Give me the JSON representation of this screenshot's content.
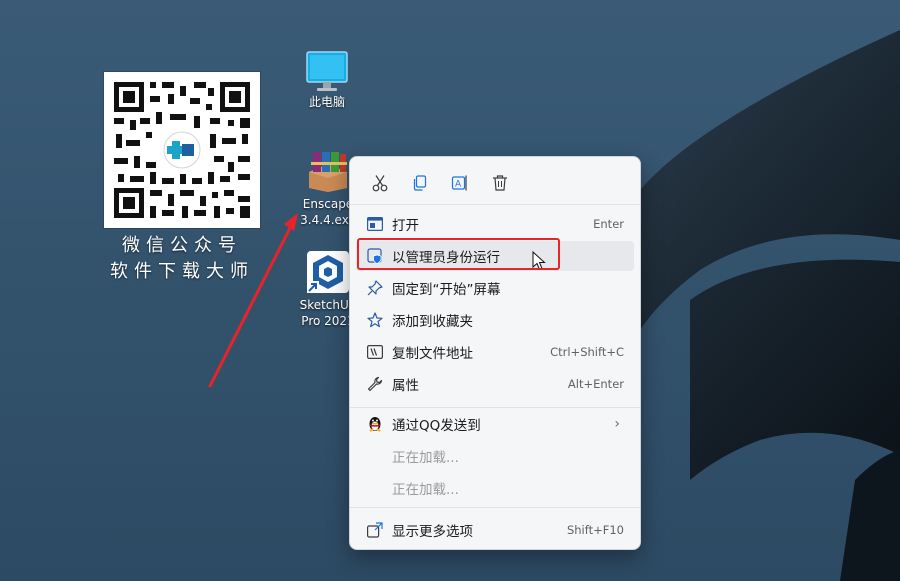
{
  "qr": {
    "caption_line1": "微信公众号",
    "caption_line2": "软件下载大师"
  },
  "desktop_icons": {
    "computer": "此电脑",
    "enscape_line1": "Enscape",
    "enscape_line2": "3.4.4.exe",
    "sketchup_line1": "SketchUp",
    "sketchup_line2": "Pro 2021"
  },
  "menu": {
    "toolbar": [
      "cut-icon",
      "copy-icon",
      "rename-icon",
      "delete-icon"
    ],
    "items": [
      {
        "label": "打开",
        "shortcut": "Enter"
      },
      {
        "label": "以管理员身份运行",
        "shortcut": ""
      },
      {
        "label": "固定到“开始”屏幕",
        "shortcut": ""
      },
      {
        "label": "添加到收藏夹",
        "shortcut": ""
      },
      {
        "label": "复制文件地址",
        "shortcut": "Ctrl+Shift+C"
      },
      {
        "label": "属性",
        "shortcut": "Alt+Enter"
      },
      {
        "label": "通过QQ发送到",
        "shortcut": ""
      },
      {
        "label": "正在加载...",
        "shortcut": ""
      },
      {
        "label": "正在加载...",
        "shortcut": ""
      },
      {
        "label": "显示更多选项",
        "shortcut": "Shift+F10"
      }
    ]
  },
  "colors": {
    "highlight_border": "#e8232a",
    "arrow": "#e8232a",
    "accent": "#1a73e8"
  }
}
